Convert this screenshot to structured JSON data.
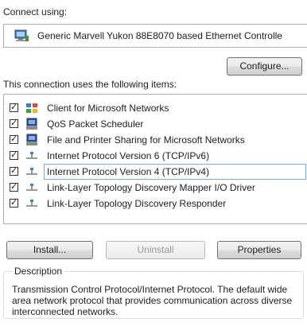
{
  "connect_using_label": "Connect using:",
  "adapter": {
    "name": "Generic Marvell Yukon 88E8070 based Ethernet Controlle",
    "icon": "network-adapter-icon"
  },
  "configure_button": "Configure...",
  "items_label": "This connection uses the following items:",
  "items": [
    {
      "label": "Client for Microsoft Networks",
      "checked": true,
      "icon": "network-client-icon"
    },
    {
      "label": "QoS Packet Scheduler",
      "checked": true,
      "icon": "computer-service-icon"
    },
    {
      "label": "File and Printer Sharing for Microsoft Networks",
      "checked": true,
      "icon": "computer-service-icon"
    },
    {
      "label": "Internet Protocol Version 6 (TCP/IPv6)",
      "checked": true,
      "icon": "protocol-icon"
    },
    {
      "label": "Internet Protocol Version 4 (TCP/IPv4)",
      "checked": true,
      "icon": "protocol-icon",
      "selected": true
    },
    {
      "label": "Link-Layer Topology Discovery Mapper I/O Driver",
      "checked": true,
      "icon": "protocol-icon"
    },
    {
      "label": "Link-Layer Topology Discovery Responder",
      "checked": true,
      "icon": "protocol-icon"
    }
  ],
  "buttons": {
    "install": "Install...",
    "uninstall": "Uninstall",
    "properties": "Properties"
  },
  "description": {
    "title": "Description",
    "text": "Transmission Control Protocol/Internet Protocol. The default wide area network protocol that provides communication across diverse interconnected networks."
  }
}
